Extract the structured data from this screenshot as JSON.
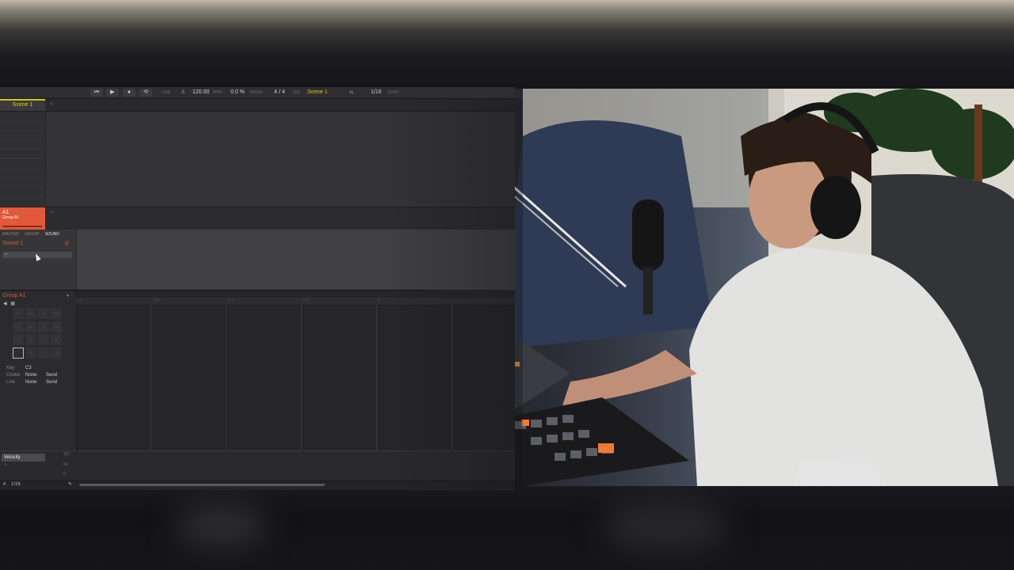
{
  "transport": {
    "buttons": [
      "⏮",
      "▶",
      "●",
      "⟲"
    ],
    "link": "LINK",
    "tempo": "120.00",
    "tempo_unit": "BPM",
    "swing": "0.0 %",
    "swing_label": "SWING",
    "signature": "4 / 4",
    "sig_label": "SIG",
    "scene": "Scene 1",
    "quantize": "1/16",
    "sync": "SYNC"
  },
  "scenes": {
    "active": "Scene 1",
    "add": "+"
  },
  "group": {
    "name": "A1",
    "sub": "Group A1",
    "add": "+"
  },
  "sound_panel": {
    "tabs": [
      "MASTER",
      "GROUP",
      "SOUND"
    ],
    "sound_name": "Sound 1",
    "slot_plus": "+"
  },
  "pattern_panel": {
    "group_name": "Group A1",
    "pads": [
      "13",
      "14",
      "15",
      "16",
      "9",
      "10",
      "11",
      "12",
      "5",
      "6",
      "7",
      "8",
      "",
      "2",
      "3",
      "4"
    ],
    "props": [
      {
        "key": "Key",
        "value": "C3",
        "extra": ""
      },
      {
        "key": "Choke",
        "value": "None",
        "extra": "Send"
      },
      {
        "key": "Link",
        "value": "None",
        "extra": "Send"
      }
    ],
    "ruler": [
      "1",
      "1.2",
      "1.3",
      "1.4",
      "2"
    ]
  },
  "velocity": {
    "label": "Velocity",
    "max": "127",
    "mid": "64",
    "min": "0",
    "plus": "+"
  },
  "status": {
    "grid": "1/16"
  }
}
